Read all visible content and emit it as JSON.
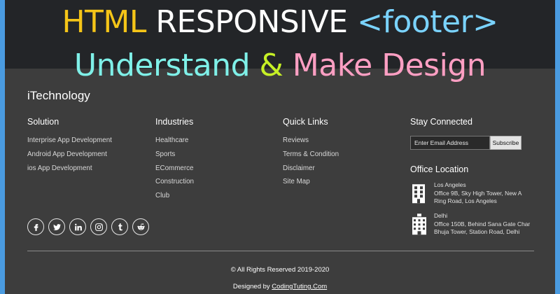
{
  "banner": {
    "line1": [
      {
        "text": "HTML",
        "color": "#f5c518"
      },
      {
        "text": " RESPONSIVE ",
        "color": "#ffffff"
      },
      {
        "text": "<footer>",
        "color": "#7ad3ff"
      }
    ],
    "line2": [
      {
        "text": "Understand ",
        "color": "#7ff0e8"
      },
      {
        "text": "&",
        "color": "#c6f026"
      },
      {
        "text": " Make Design",
        "color": "#ff9fc3"
      }
    ]
  },
  "brand": "iTechnology",
  "columns": [
    {
      "title": "Solution",
      "items": [
        "Interprise App Development",
        "Android App Development",
        "ios App Development"
      ]
    },
    {
      "title": "Industries",
      "items": [
        "Healthcare",
        "Sports",
        "ECommerce",
        "Construction",
        "Club"
      ]
    },
    {
      "title": "Quick Links",
      "items": [
        "Reviews",
        "Terms & Condition",
        "Disclaimer",
        "Site Map"
      ]
    }
  ],
  "stay": {
    "title": "Stay Connected",
    "email_placeholder": "Enter Email Address",
    "subscribe_label": "Subscribe"
  },
  "office": {
    "title": "Office Location",
    "locations": [
      {
        "city": "Los Angeles",
        "line1": "Office 9B, Sky High Tower, New A",
        "line2": "Ring Road, Los Angeles"
      },
      {
        "city": "Delhi",
        "line1": "Office 150B, Behind Sana Gate Char",
        "line2": "Bhuja Tower, Station Road, Delhi"
      }
    ]
  },
  "socials": [
    "facebook-icon",
    "twitter-icon",
    "linkedin-icon",
    "instagram-icon",
    "tumblr-icon",
    "reddit-icon"
  ],
  "footer": {
    "copyright": "© All Rights Reserved 2019-2020",
    "designed_prefix": "Designed by ",
    "designed_link": "CodingTuting.Com"
  }
}
